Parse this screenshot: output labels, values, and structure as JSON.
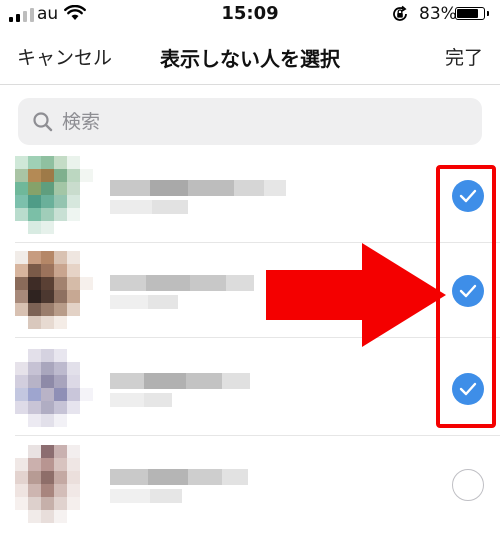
{
  "status_bar": {
    "carrier": "au",
    "time": "15:09",
    "battery_percent": "83%",
    "battery_level": 0.83,
    "icons": [
      "signal-icon",
      "wifi-icon",
      "orientation-lock-icon",
      "battery-icon"
    ]
  },
  "nav": {
    "cancel_label": "キャンセル",
    "title": "表示しない人を選択",
    "done_label": "完了"
  },
  "search": {
    "placeholder": "検索",
    "value": "",
    "icon": "search-icon"
  },
  "contacts": [
    {
      "selected": true
    },
    {
      "selected": true
    },
    {
      "selected": true
    },
    {
      "selected": false
    }
  ],
  "annotation": {
    "highlight_color": "#f40000",
    "arrow_color": "#f40000",
    "check_color": "#3e8ee8"
  }
}
